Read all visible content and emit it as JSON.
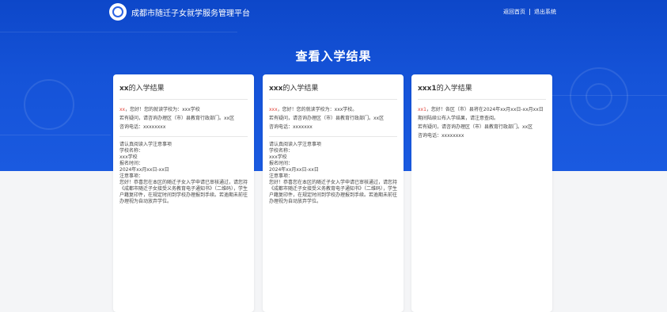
{
  "header": {
    "app_title": "成都市随迁子女就学服务管理平台",
    "nav_home": "返回首页",
    "nav_logout": "退出系统"
  },
  "page": {
    "title": "查看入学结果"
  },
  "cards": [
    {
      "name_bold": "xx",
      "title_suffix": "的入学结果",
      "greeting_name": "xx",
      "greeting_rest": "，您好！您的就读学校为：xxx学校",
      "contact_line": "若有疑问，请咨询办理区（市）县教育行政部门。xx区",
      "phone_line": "咨询电话：xxxxxxxx",
      "notes": [
        "请认真阅读入学注意事项",
        "学校名称：",
        "xxx学校",
        "报名时间：",
        "2024年xx月xx日-xx日",
        "注意事项：",
        "您好！恭喜您在本区的随迁子女入学申请已审核通过，请您持《成都市随迁子女接受义务教育电子通知书》（二维码），学生户籍复印件，在规定时间到学校办理报到手续。若逾期未前往办理视为自动放弃学位。"
      ]
    },
    {
      "name_bold": "xxx",
      "title_suffix": "的入学结果",
      "greeting_name": "xxx",
      "greeting_rest": "，您好！您的就读学校为：xxx学校。",
      "contact_line": "若有疑问，请咨询办理区（市）县教育行政部门。xx区",
      "phone_line": "咨询电话：xxxxxxx",
      "notes": [
        "请认真阅读入学注意事项",
        "学校名称：",
        "xxx学校",
        "报名时间：",
        "2024年xx月xx日-xx日",
        "注意事项：",
        "您好！恭喜您在本区的随迁子女入学申请已审核通过，请您持《成都市随迁子女接受义务教育电子通知书》（二维码），学生户籍复印件，在规定时间到学校办理报到手续。若逾期未前往办理视为自动放弃学位。"
      ]
    },
    {
      "name_bold": "xxx1",
      "title_suffix": "的入学结果",
      "greeting_name": "xx1",
      "greeting_rest": "，您好！各区（市）县将在2024年xx月xx日-xx月xx日期间陆续公布入学结果，请注意查阅。",
      "contact_line": "若有疑问，请咨询办理区（市）县教育行政部门。xx区",
      "phone_line": "咨询电话：xxxxxxxx",
      "notes": []
    }
  ]
}
